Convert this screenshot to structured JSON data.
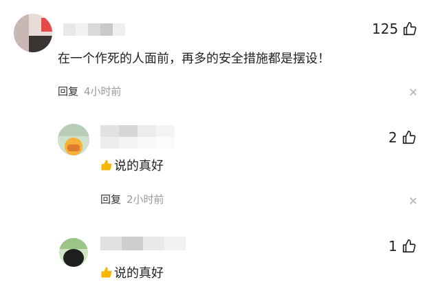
{
  "comments": [
    {
      "likes": "125",
      "text": "在一个作死的人面前，再多的安全措施都是摆设！",
      "reply_label": "回复",
      "time": "4小时前"
    },
    {
      "likes": "2",
      "emoji": "thumbs-up-emoji",
      "text": "说的真好",
      "reply_label": "回复",
      "time": "2小时前"
    },
    {
      "likes": "1",
      "emoji": "thumbs-up-emoji",
      "text": "说的真好"
    }
  ],
  "icons": {
    "like": "thumbs-up-icon",
    "close": "close-icon"
  },
  "colors": {
    "text": "#222222",
    "muted": "#999999",
    "emoji": "#f5b400"
  }
}
